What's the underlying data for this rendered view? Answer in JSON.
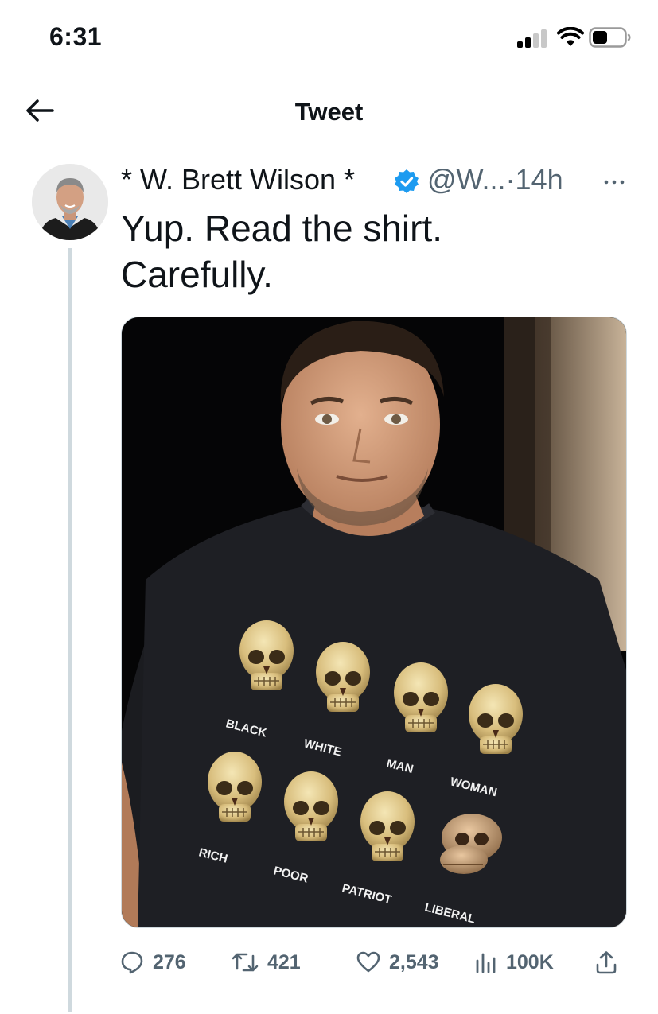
{
  "status_bar": {
    "time": "6:31"
  },
  "header": {
    "title": "Tweet",
    "back_icon": "arrow-left-icon"
  },
  "tweet": {
    "author_name": "* W. Brett Wilson *",
    "verified_icon": "verified-badge-icon",
    "handle": "@W...",
    "separator": "·",
    "time_ago": "14h",
    "more_icon": "more-horizontal-icon",
    "text_lines": [
      "Yup. Read the shirt.",
      "Carefully."
    ],
    "media": {
      "description_icon": "photo-image",
      "shirt_labels": [
        "BLACK",
        "WHITE",
        "MAN",
        "WOMAN",
        "RICH",
        "POOR",
        "PATRIOT",
        "LIBERAL"
      ]
    },
    "actions": {
      "replies": "276",
      "retweets": "421",
      "likes": "2,543",
      "views": "100K",
      "reply_icon": "reply-icon",
      "retweet_icon": "retweet-icon",
      "like_icon": "heart-icon",
      "views_icon": "analytics-icon",
      "share_icon": "share-icon"
    }
  },
  "colors": {
    "text_primary": "#0f1419",
    "text_secondary": "#536471",
    "verified_blue": "#1d9bf0",
    "thread_line": "#cfd9de"
  }
}
